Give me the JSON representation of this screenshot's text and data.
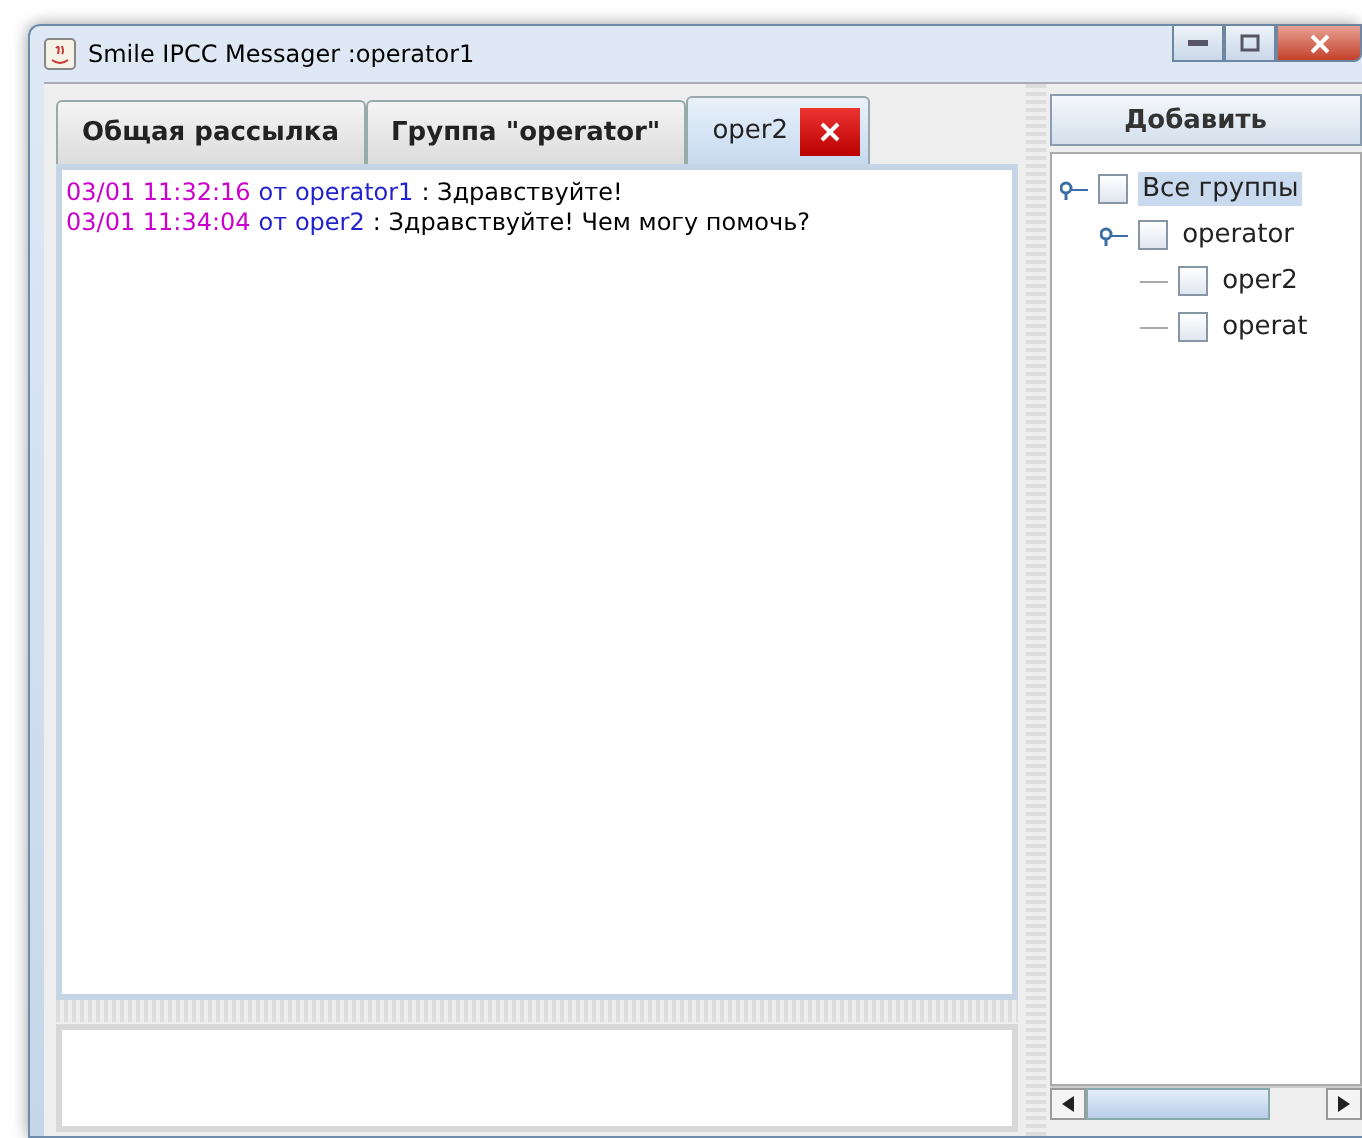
{
  "window": {
    "title": "Smile IPCC Messager :operator1"
  },
  "tabs": [
    {
      "label": "Общая рассылка",
      "selected": false,
      "closable": false
    },
    {
      "label": "Группа \"operator\"",
      "selected": false,
      "closable": false
    },
    {
      "label": "oper2",
      "selected": true,
      "closable": true
    }
  ],
  "messages": [
    {
      "time": "03/01 11:32:16",
      "from": "от operator1",
      "text": ": Здравствуйте!"
    },
    {
      "time": "03/01 11:34:04",
      "from": "от oper2",
      "text": ": Здравствуйте! Чем могу помочь?"
    }
  ],
  "add_button": "Добавить",
  "tree": [
    {
      "label": "Все группы",
      "selected": true,
      "checked": false,
      "expanded": true,
      "children": [
        {
          "label": "operator",
          "selected": false,
          "checked": false,
          "expanded": true,
          "children": [
            {
              "label": "oper2",
              "selected": false,
              "checked": false
            },
            {
              "label": "operat",
              "selected": false,
              "checked": false
            }
          ]
        }
      ]
    }
  ]
}
